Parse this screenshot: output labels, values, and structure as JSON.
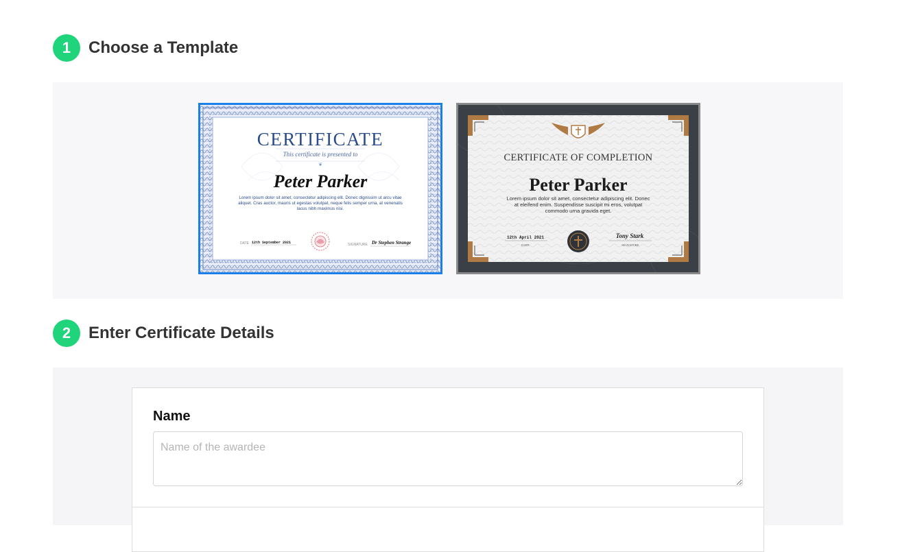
{
  "steps": [
    {
      "number": "1",
      "title": "Choose a Template"
    },
    {
      "number": "2",
      "title": "Enter Certificate Details"
    }
  ],
  "templates": [
    {
      "heading": "CERTIFICATE",
      "subtitle": "This certificate is presented to",
      "name": "Peter Parker",
      "body": "Lorem ipsum dolor sit amet, consectetur adipiscing elit. Donec dignissim ut arcu vitae aliquet. Cras auctor, mauris ut egestas volutpat, neque felis semper urna, at venenatis lacus nibh maximus nisi.",
      "date_label": "DATE",
      "date_value": "12th September 2021",
      "signature_label": "SIGNATURE",
      "signature": "Dr Stephen Strange",
      "selected": true
    },
    {
      "heading": "CERTIFICATE OF COMPLETION",
      "name": "Peter Parker",
      "body": "Lorem ipsum dolor sit amet, consectetur adipiscing elit. Donec at eleifend enim. Suspendisse suscipit mi eros, volutpat commodo urna gravida eget.",
      "date_value": "12th April 2021",
      "date_label": "DATE",
      "signature": "Tony Stark",
      "signature_label": "SIGNATURE",
      "selected": false
    }
  ],
  "form": {
    "name_label": "Name",
    "name_placeholder": "Name of the awardee",
    "name_value": ""
  },
  "colors": {
    "accent": "#1fd47a",
    "selected_border": "#1a7fe8",
    "cert1_blue": "#2b4c8c",
    "cert2_gold": "#b07a45"
  }
}
